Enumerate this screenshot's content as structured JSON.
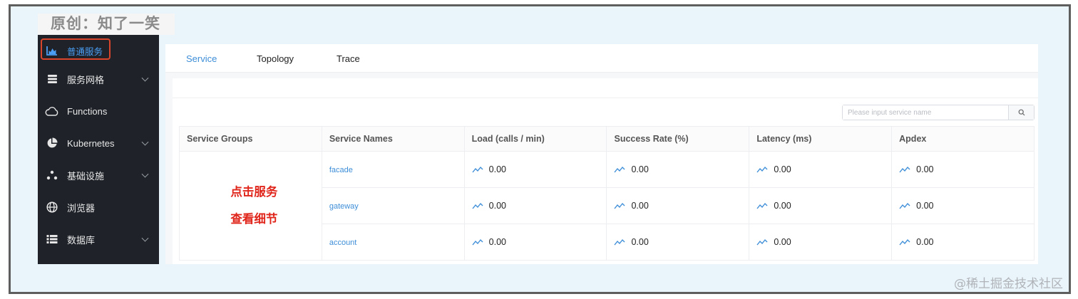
{
  "watermark_top": "原创：知了一笑",
  "watermark_bottom": "@稀土掘金技术社区",
  "sidebar": {
    "items": [
      {
        "label": "普通服务",
        "icon": "area-chart-icon",
        "active": true
      },
      {
        "label": "服务网格",
        "icon": "database-icon",
        "chevron": true
      },
      {
        "label": "Functions",
        "icon": "cloud-icon"
      },
      {
        "label": "Kubernetes",
        "icon": "pie-chart-icon",
        "chevron": true
      },
      {
        "label": "基础设施",
        "icon": "dots-cluster-icon",
        "chevron": true
      },
      {
        "label": "浏览器",
        "icon": "globe-icon"
      },
      {
        "label": "数据库",
        "icon": "list-icon",
        "chevron": true
      }
    ]
  },
  "tabs": [
    {
      "label": "Service",
      "active": true
    },
    {
      "label": "Topology"
    },
    {
      "label": "Trace"
    }
  ],
  "search": {
    "placeholder": "Please input service name",
    "button_icon": "search-icon"
  },
  "table": {
    "headers": [
      "Service Groups",
      "Service Names",
      "Load (calls / min)",
      "Success Rate (%)",
      "Latency (ms)",
      "Apdex"
    ],
    "rows": [
      {
        "name": "facade",
        "load": "0.00",
        "success": "0.00",
        "latency": "0.00",
        "apdex": "0.00"
      },
      {
        "name": "gateway",
        "load": "0.00",
        "success": "0.00",
        "latency": "0.00",
        "apdex": "0.00"
      },
      {
        "name": "account",
        "load": "0.00",
        "success": "0.00",
        "latency": "0.00",
        "apdex": "0.00"
      }
    ]
  },
  "annotation": {
    "line1": "点击服务",
    "line2": "查看细节"
  },
  "colors": {
    "accent": "#3e8ed8",
    "highlight_border": "#d9452b",
    "annotation": "#e0251b",
    "sidebar_bg": "#1f2329"
  }
}
